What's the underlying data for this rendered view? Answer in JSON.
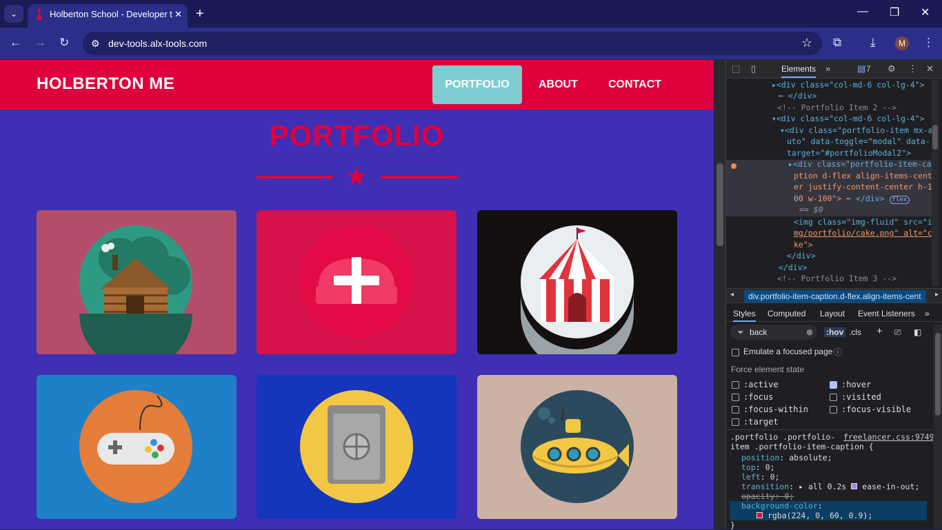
{
  "browser": {
    "tab_title": "Holberton School - Developer t",
    "tab_close": "✕",
    "new_tab": "+",
    "url": "dev-tools.alx-tools.com",
    "profile_initial": "M"
  },
  "site": {
    "brand": "HOLBERTON ME",
    "nav": [
      {
        "label": "PORTFOLIO",
        "active": true
      },
      {
        "label": "ABOUT",
        "active": false
      },
      {
        "label": "CONTACT",
        "active": false
      }
    ],
    "section_title": "PORTFOLIO",
    "portfolio_items": [
      {
        "name": "cabin",
        "bg": "#b44d6a"
      },
      {
        "name": "cake",
        "bg": "#d5134a"
      },
      {
        "name": "circus",
        "bg": "#151010"
      },
      {
        "name": "game",
        "bg": "#1e80c6"
      },
      {
        "name": "safe",
        "bg": "#1535bd"
      },
      {
        "name": "submarine",
        "bg": "#cbb2a5"
      }
    ]
  },
  "devtools": {
    "tabs": {
      "elements": "Elements",
      "issues_count": "7"
    },
    "dom_lines": [
      {
        "text": "<div class=\"col-md-6 col-lg-4\">"
      },
      {
        "text": "</div>"
      },
      {
        "text": "<!-- Portfolio Item 2 -->"
      },
      {
        "text": "<div class=\"col-md-6 col-lg-4\">"
      },
      {
        "text": "<div class=\"portfolio-item mx-a"
      },
      {
        "text": "uto\" data-toggle=\"modal\" data-"
      },
      {
        "text": "target=\"#portfolioModal2\">"
      },
      {
        "text": "<div class=\"portfolio-item-ca"
      },
      {
        "text": "ption d-flex align-items-cent"
      },
      {
        "text": "er justify-content-center h-1"
      },
      {
        "text": "00 w-100\">"
      },
      {
        "text": "== $0"
      },
      {
        "text": "<img class=\"img-fluid\" src=\"i"
      },
      {
        "text": "mg/portfolio/cake.png\" alt=\"ca"
      },
      {
        "text": "ke\">"
      },
      {
        "text": "</div>"
      },
      {
        "text": "</div>"
      },
      {
        "text": "<!-- Portfolio Item 3 -->"
      }
    ],
    "flex_badge": "flex",
    "breadcrumb": "div.portfolio-item-caption.d-flex.align-items-cent",
    "style_tabs": [
      "Styles",
      "Computed",
      "Layout",
      "Event Listeners"
    ],
    "filter_value": "back",
    "hov": ":hov",
    "cls": ".cls",
    "emulate_focus": "Emulate a focused page",
    "force_state_title": "Force element state",
    "states": [
      {
        "label": ":active",
        "checked": false
      },
      {
        "label": ":hover",
        "checked": true
      },
      {
        "label": ":focus",
        "checked": false
      },
      {
        "label": ":visited",
        "checked": false
      },
      {
        "label": ":focus-within",
        "checked": false
      },
      {
        "label": ":focus-visible",
        "checked": false
      },
      {
        "label": ":target",
        "checked": false
      }
    ],
    "rule": {
      "selector_1": ".portfolio .portfolio-",
      "selector_2": "item .portfolio-item-caption {",
      "source": "freelancer.css:9749",
      "decls": [
        {
          "prop": "position",
          "value": "absolute;"
        },
        {
          "prop": "top",
          "value": "0;"
        },
        {
          "prop": "left",
          "value": "0;"
        },
        {
          "prop": "transition",
          "value": "all 0.2s",
          "extra": "ease-in-out;"
        },
        {
          "prop": "opacity",
          "value": "0;"
        },
        {
          "prop": "background-color",
          "value": "rgba(224, 0, 60, 0.9);"
        }
      ],
      "close": "}"
    },
    "swatch_color": "#e0003c"
  }
}
